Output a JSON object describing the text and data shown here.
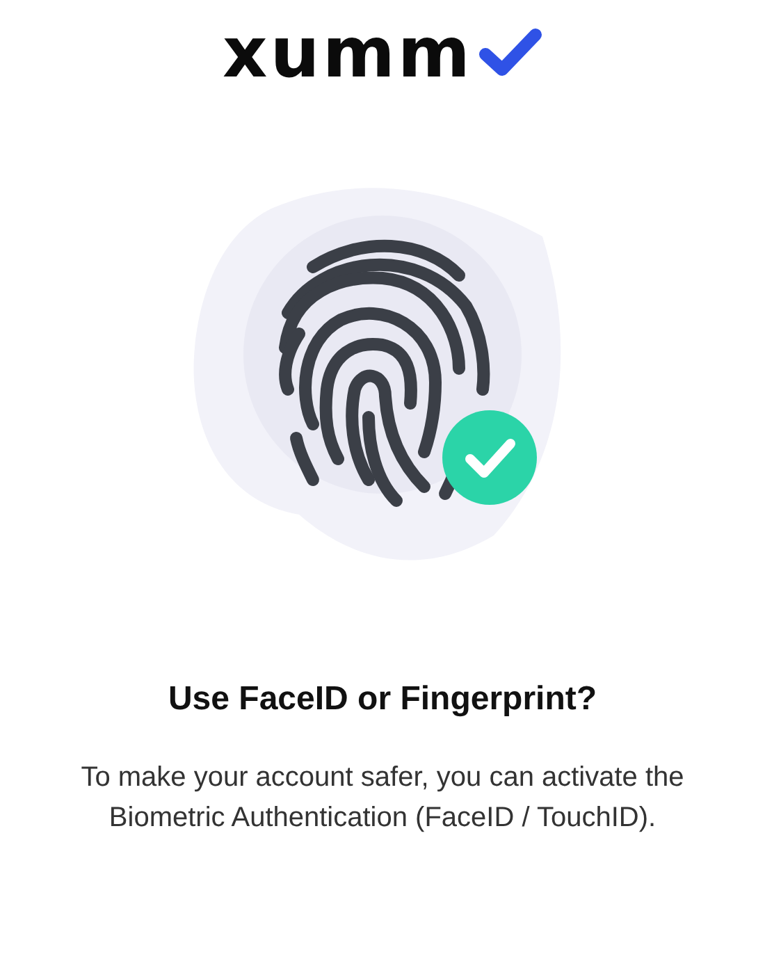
{
  "logo": {
    "text": "xumm"
  },
  "title": "Use FaceID or Fingerprint?",
  "description": "To make your account safer, you can activate the Biometric Authentication (FaceID / TouchID)."
}
